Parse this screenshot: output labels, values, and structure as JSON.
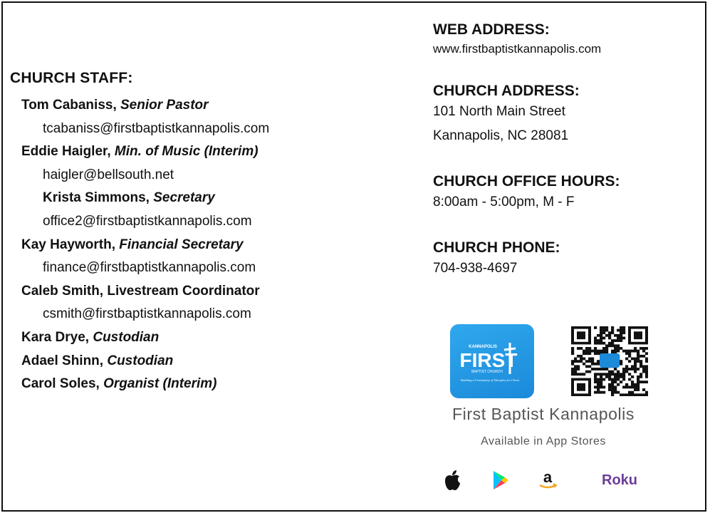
{
  "staff": {
    "heading": "CHURCH STAFF:",
    "members": [
      {
        "name": "Tom Cabaniss,",
        "role": " Senior Pastor",
        "email": "tcabaniss@firstbaptistkannapolis.com"
      },
      {
        "name": "Eddie Haigler,",
        "role": " Min. of Music (Interim)",
        "email": "haigler@bellsouth.net"
      },
      {
        "name": "Krista Simmons,",
        "role": " Secretary",
        "email": "office2@firstbaptistkannapolis.com"
      },
      {
        "name": "Kay Hayworth,",
        "role": " Financial Secretary",
        "email": "finance@firstbaptistkannapolis.com"
      },
      {
        "name": "Caleb Smith,",
        "role": " Livestream Coordinator",
        "email": "csmith@firstbaptistkannapolis.com"
      },
      {
        "name": "Kara Drye,",
        "role": " Custodian"
      },
      {
        "name": "Adael Shinn,",
        "role": " Custodian"
      },
      {
        "name": "Carol Soles,",
        "role": " Organist (Interim)"
      }
    ]
  },
  "web": {
    "heading": "WEB ADDRESS:",
    "value": "www.firstbaptistkannapolis.com"
  },
  "address": {
    "heading": "CHURCH ADDRESS:",
    "line1": "101 North Main Street",
    "line2": "Kannapolis, NC 28081"
  },
  "hours": {
    "heading": "CHURCH OFFICE HOURS:",
    "value": "8:00am - 5:00pm, M - F"
  },
  "phone": {
    "heading": "CHURCH PHONE:",
    "value": "704-938-4697"
  },
  "app": {
    "logo_small": "KANNAPOLIS",
    "logo_big": "FIRST",
    "logo_sub": "BAPTIST CHURCH",
    "logo_tagline": "Building a Community of Disciples for Christ",
    "name": "First Baptist Kannapolis",
    "available": "Available in App Stores",
    "stores": {
      "amazon": "a",
      "roku": "Roku"
    },
    "accent": "#1b8ad9"
  }
}
